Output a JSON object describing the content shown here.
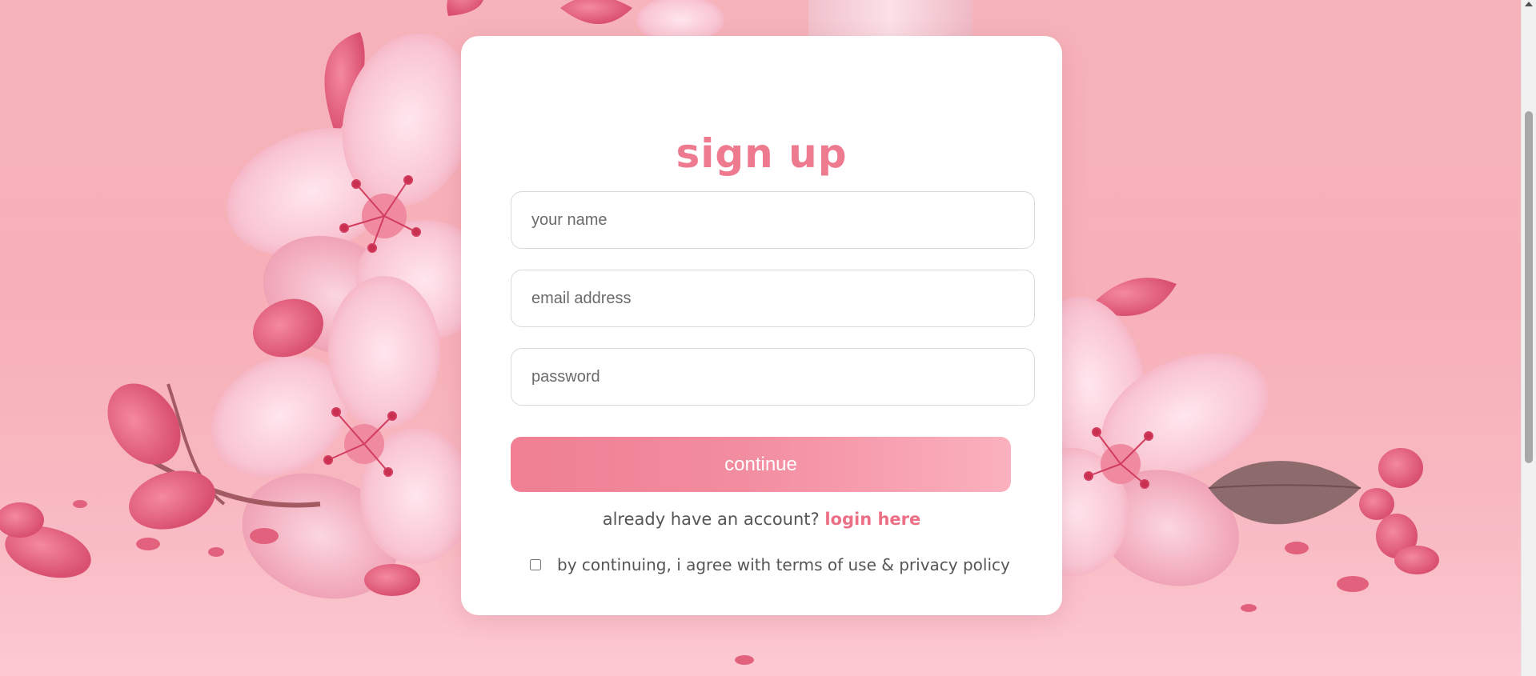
{
  "form": {
    "title": "sign up",
    "name_placeholder": "your name",
    "email_placeholder": "email address",
    "password_placeholder": "password",
    "continue_label": "continue",
    "login_prompt": "already have an account?",
    "login_link": "login here",
    "terms_label": "by continuing, i agree with terms of use & privacy policy",
    "terms_checked": false
  },
  "theme": {
    "accent": "#ee7a8f",
    "button_gradient_start": "#f07f93",
    "button_gradient_end": "#fbb1bf",
    "background": "#f6b3ba"
  },
  "background_art": {
    "subject": "pink cherry blossom flowers and petals",
    "icon": "cherry-blossom-illustration"
  }
}
